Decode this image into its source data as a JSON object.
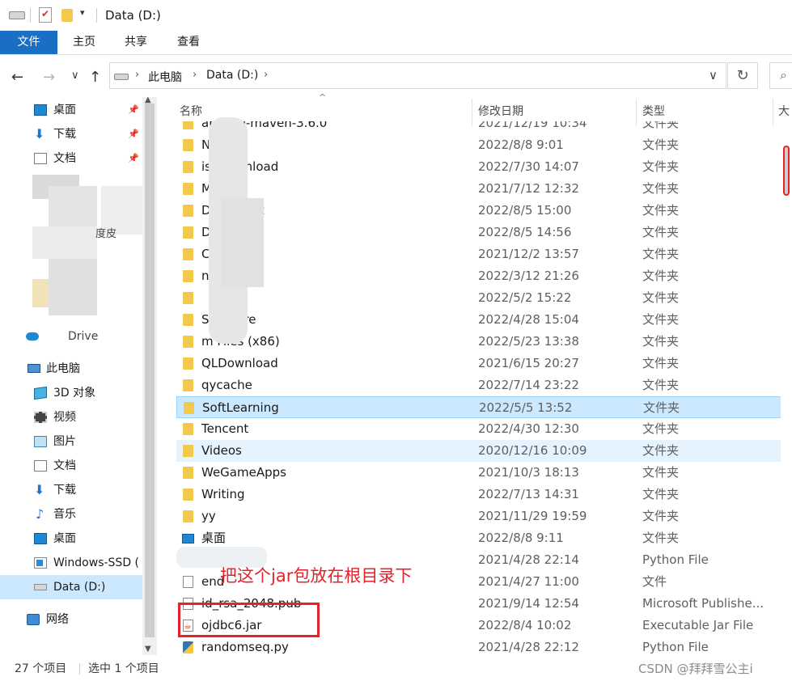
{
  "window": {
    "title": "Data (D:)"
  },
  "ribbon": {
    "tabs": [
      {
        "label": "文件"
      },
      {
        "label": "主页"
      },
      {
        "label": "共享"
      },
      {
        "label": "查看"
      }
    ]
  },
  "address": {
    "crumbs": [
      "此电脑",
      "Data (D:)"
    ]
  },
  "sidebar": {
    "items": [
      {
        "label": "桌面",
        "icon": "desktop-icon",
        "pinned": true
      },
      {
        "label": "下载",
        "icon": "download-icon",
        "pinned": true
      },
      {
        "label": "文档",
        "icon": "document-icon",
        "pinned": true
      },
      {
        "label": "此电脑",
        "icon": "pc-icon"
      },
      {
        "label": "3D 对象",
        "icon": "3d-objects-icon"
      },
      {
        "label": "视频",
        "icon": "video-icon"
      },
      {
        "label": "图片",
        "icon": "pictures-icon"
      },
      {
        "label": "文档",
        "icon": "document-icon"
      },
      {
        "label": "下载",
        "icon": "download-icon"
      },
      {
        "label": "音乐",
        "icon": "music-icon"
      },
      {
        "label": "桌面",
        "icon": "desktop-icon"
      },
      {
        "label": "Windows-SSD (",
        "icon": "windows-drive-icon"
      },
      {
        "label": "Data (D:)",
        "icon": "drive-icon",
        "selected": true
      },
      {
        "label": "网络",
        "icon": "network-icon"
      }
    ],
    "partial": {
      "onedrive": "Drive",
      "desk_fragment": "度皮"
    }
  },
  "columns": {
    "name": "名称",
    "date": "修改日期",
    "type": "类型",
    "size": "大"
  },
  "files": [
    {
      "name": "apache-maven-3.6.0",
      "date": "2021/12/19 10:34",
      "type": "文件夹",
      "icon": "folder"
    },
    {
      "name": "Netdisk",
      "date": "2022/8/8 9:01",
      "type": "文件夹",
      "icon": "folder"
    },
    {
      "name": "iskDownload",
      "date": "2022/7/30 14:07",
      "type": "文件夹",
      "icon": "folder"
    },
    {
      "name": "Mu",
      "date": "2021/7/12 12:32",
      "type": "文件夹",
      "icon": "folder"
    },
    {
      "name": "Document",
      "date": "2022/8/5 15:00",
      "type": "文件夹",
      "icon": "folder"
    },
    {
      "name": "Download",
      "date": "2022/8/5 14:56",
      "type": "文件夹",
      "icon": "folder"
    },
    {
      "name": "C",
      "date": "2021/12/2 13:57",
      "type": "文件夹",
      "icon": "folder"
    },
    {
      "name": "nload",
      "date": "2022/3/12 21:26",
      "type": "文件夹",
      "icon": "folder"
    },
    {
      "name": "",
      "date": "2022/5/2 15:22",
      "type": "文件夹",
      "icon": "folder"
    },
    {
      "name": "Softstore",
      "date": "2022/4/28 15:04",
      "type": "文件夹",
      "icon": "folder"
    },
    {
      "name": "m Files (x86)",
      "date": "2022/5/23 13:38",
      "type": "文件夹",
      "icon": "folder"
    },
    {
      "name": "QLDownload",
      "date": "2021/6/15 20:27",
      "type": "文件夹",
      "icon": "folder"
    },
    {
      "name": "qycache",
      "date": "2022/7/14 23:22",
      "type": "文件夹",
      "icon": "folder"
    },
    {
      "name": "SoftLearning",
      "date": "2022/5/5 13:52",
      "type": "文件夹",
      "icon": "folder",
      "selected": true
    },
    {
      "name": "Tencent",
      "date": "2022/4/30 12:30",
      "type": "文件夹",
      "icon": "folder"
    },
    {
      "name": "Videos",
      "date": "2020/12/16 10:09",
      "type": "文件夹",
      "icon": "folder",
      "hover": true
    },
    {
      "name": "WeGameApps",
      "date": "2021/10/3 18:13",
      "type": "文件夹",
      "icon": "folder"
    },
    {
      "name": "Writing",
      "date": "2022/7/13 14:31",
      "type": "文件夹",
      "icon": "folder"
    },
    {
      "name": "yy",
      "date": "2021/11/29 19:59",
      "type": "文件夹",
      "icon": "folder"
    },
    {
      "name": "桌面",
      "date": "2022/8/8 9:11",
      "type": "文件夹",
      "icon": "desktop"
    },
    {
      "name": "",
      "date": "2021/4/28 22:14",
      "type": "Python File",
      "icon": "python"
    },
    {
      "name": "end",
      "date": "2021/4/27 11:00",
      "type": "文件",
      "icon": "plain"
    },
    {
      "name": "id_rsa_2048.pub",
      "date": "2021/9/14 12:54",
      "type": "Microsoft Publishe...",
      "icon": "pub"
    },
    {
      "name": "ojdbc6.jar",
      "date": "2022/8/4 10:02",
      "type": "Executable Jar File",
      "icon": "jar"
    },
    {
      "name": "randomseq.py",
      "date": "2021/4/28 22:12",
      "type": "Python File",
      "icon": "python"
    }
  ],
  "annotation": {
    "text": "把这个jar包放在根目录下"
  },
  "status": {
    "count": "27 个项目",
    "selection": "选中 1 个项目"
  },
  "watermark": "CSDN @拜拜雪公主i",
  "colors": {
    "accent": "#1a6fc4",
    "selection": "#cce8ff",
    "annotation": "#e5222a",
    "folder": "#f2c94c"
  }
}
